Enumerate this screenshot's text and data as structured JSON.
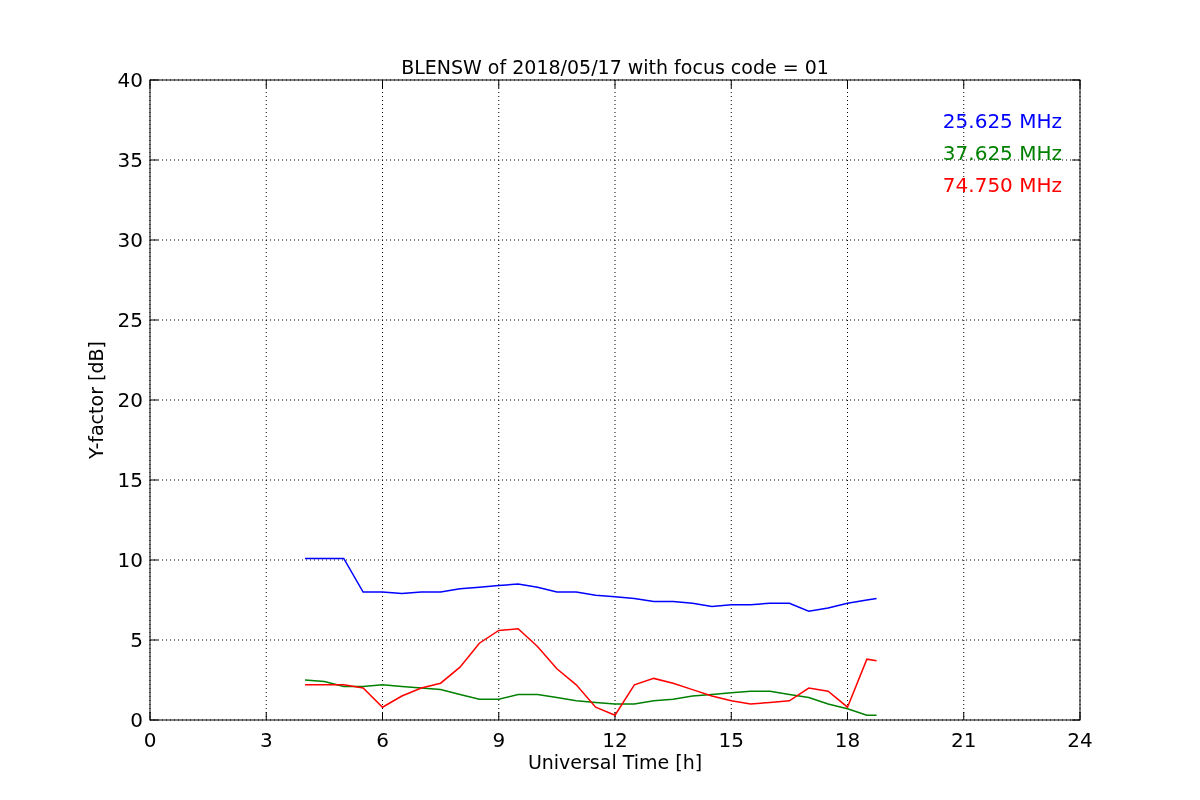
{
  "chart_data": {
    "type": "line",
    "title": "BLENSW of 2018/05/17 with focus code = 01",
    "xlabel": "Universal Time [h]",
    "ylabel": "Y-factor [dB]",
    "x": [
      4,
      4.5,
      5,
      5.5,
      6,
      6.5,
      7,
      7.5,
      8,
      8.5,
      9,
      9.5,
      10,
      10.5,
      11,
      11.5,
      12,
      12.5,
      13,
      13.5,
      14,
      14.5,
      15,
      15.5,
      16,
      16.5,
      17,
      17.5,
      18,
      18.5,
      18.75
    ],
    "series": [
      {
        "name": "25.625 MHz",
        "color": "#0000ff",
        "values": [
          10.1,
          10.1,
          10.1,
          8.0,
          8.0,
          7.9,
          8.0,
          8.0,
          8.2,
          8.3,
          8.4,
          8.5,
          8.3,
          8.0,
          8.0,
          7.8,
          7.7,
          7.6,
          7.4,
          7.4,
          7.3,
          7.1,
          7.2,
          7.2,
          7.3,
          7.3,
          6.8,
          7.0,
          7.3,
          7.5,
          7.6
        ]
      },
      {
        "name": "37.625 MHz",
        "color": "#008000",
        "values": [
          2.5,
          2.4,
          2.1,
          2.1,
          2.2,
          2.1,
          2.0,
          1.9,
          1.6,
          1.3,
          1.3,
          1.6,
          1.6,
          1.4,
          1.2,
          1.1,
          1.0,
          1.0,
          1.2,
          1.3,
          1.5,
          1.6,
          1.7,
          1.8,
          1.8,
          1.6,
          1.4,
          1.0,
          0.7,
          0.3,
          0.3
        ]
      },
      {
        "name": "74.750 MHz",
        "color": "#ff0000",
        "values": [
          2.2,
          2.2,
          2.2,
          2.0,
          0.8,
          1.5,
          2.0,
          2.3,
          3.3,
          4.8,
          5.6,
          5.7,
          4.6,
          3.2,
          2.2,
          0.8,
          0.3,
          2.2,
          2.6,
          2.3,
          1.9,
          1.5,
          1.2,
          1.0,
          1.1,
          1.2,
          2.0,
          1.8,
          0.8,
          3.8,
          3.7
        ]
      }
    ],
    "grid": true,
    "xlim": [
      0,
      24
    ],
    "ylim": [
      0,
      40
    ],
    "xticks": [
      0,
      3,
      6,
      9,
      12,
      15,
      18,
      21,
      24
    ],
    "yticks": [
      0,
      5,
      10,
      15,
      20,
      25,
      30,
      35,
      40
    ]
  }
}
